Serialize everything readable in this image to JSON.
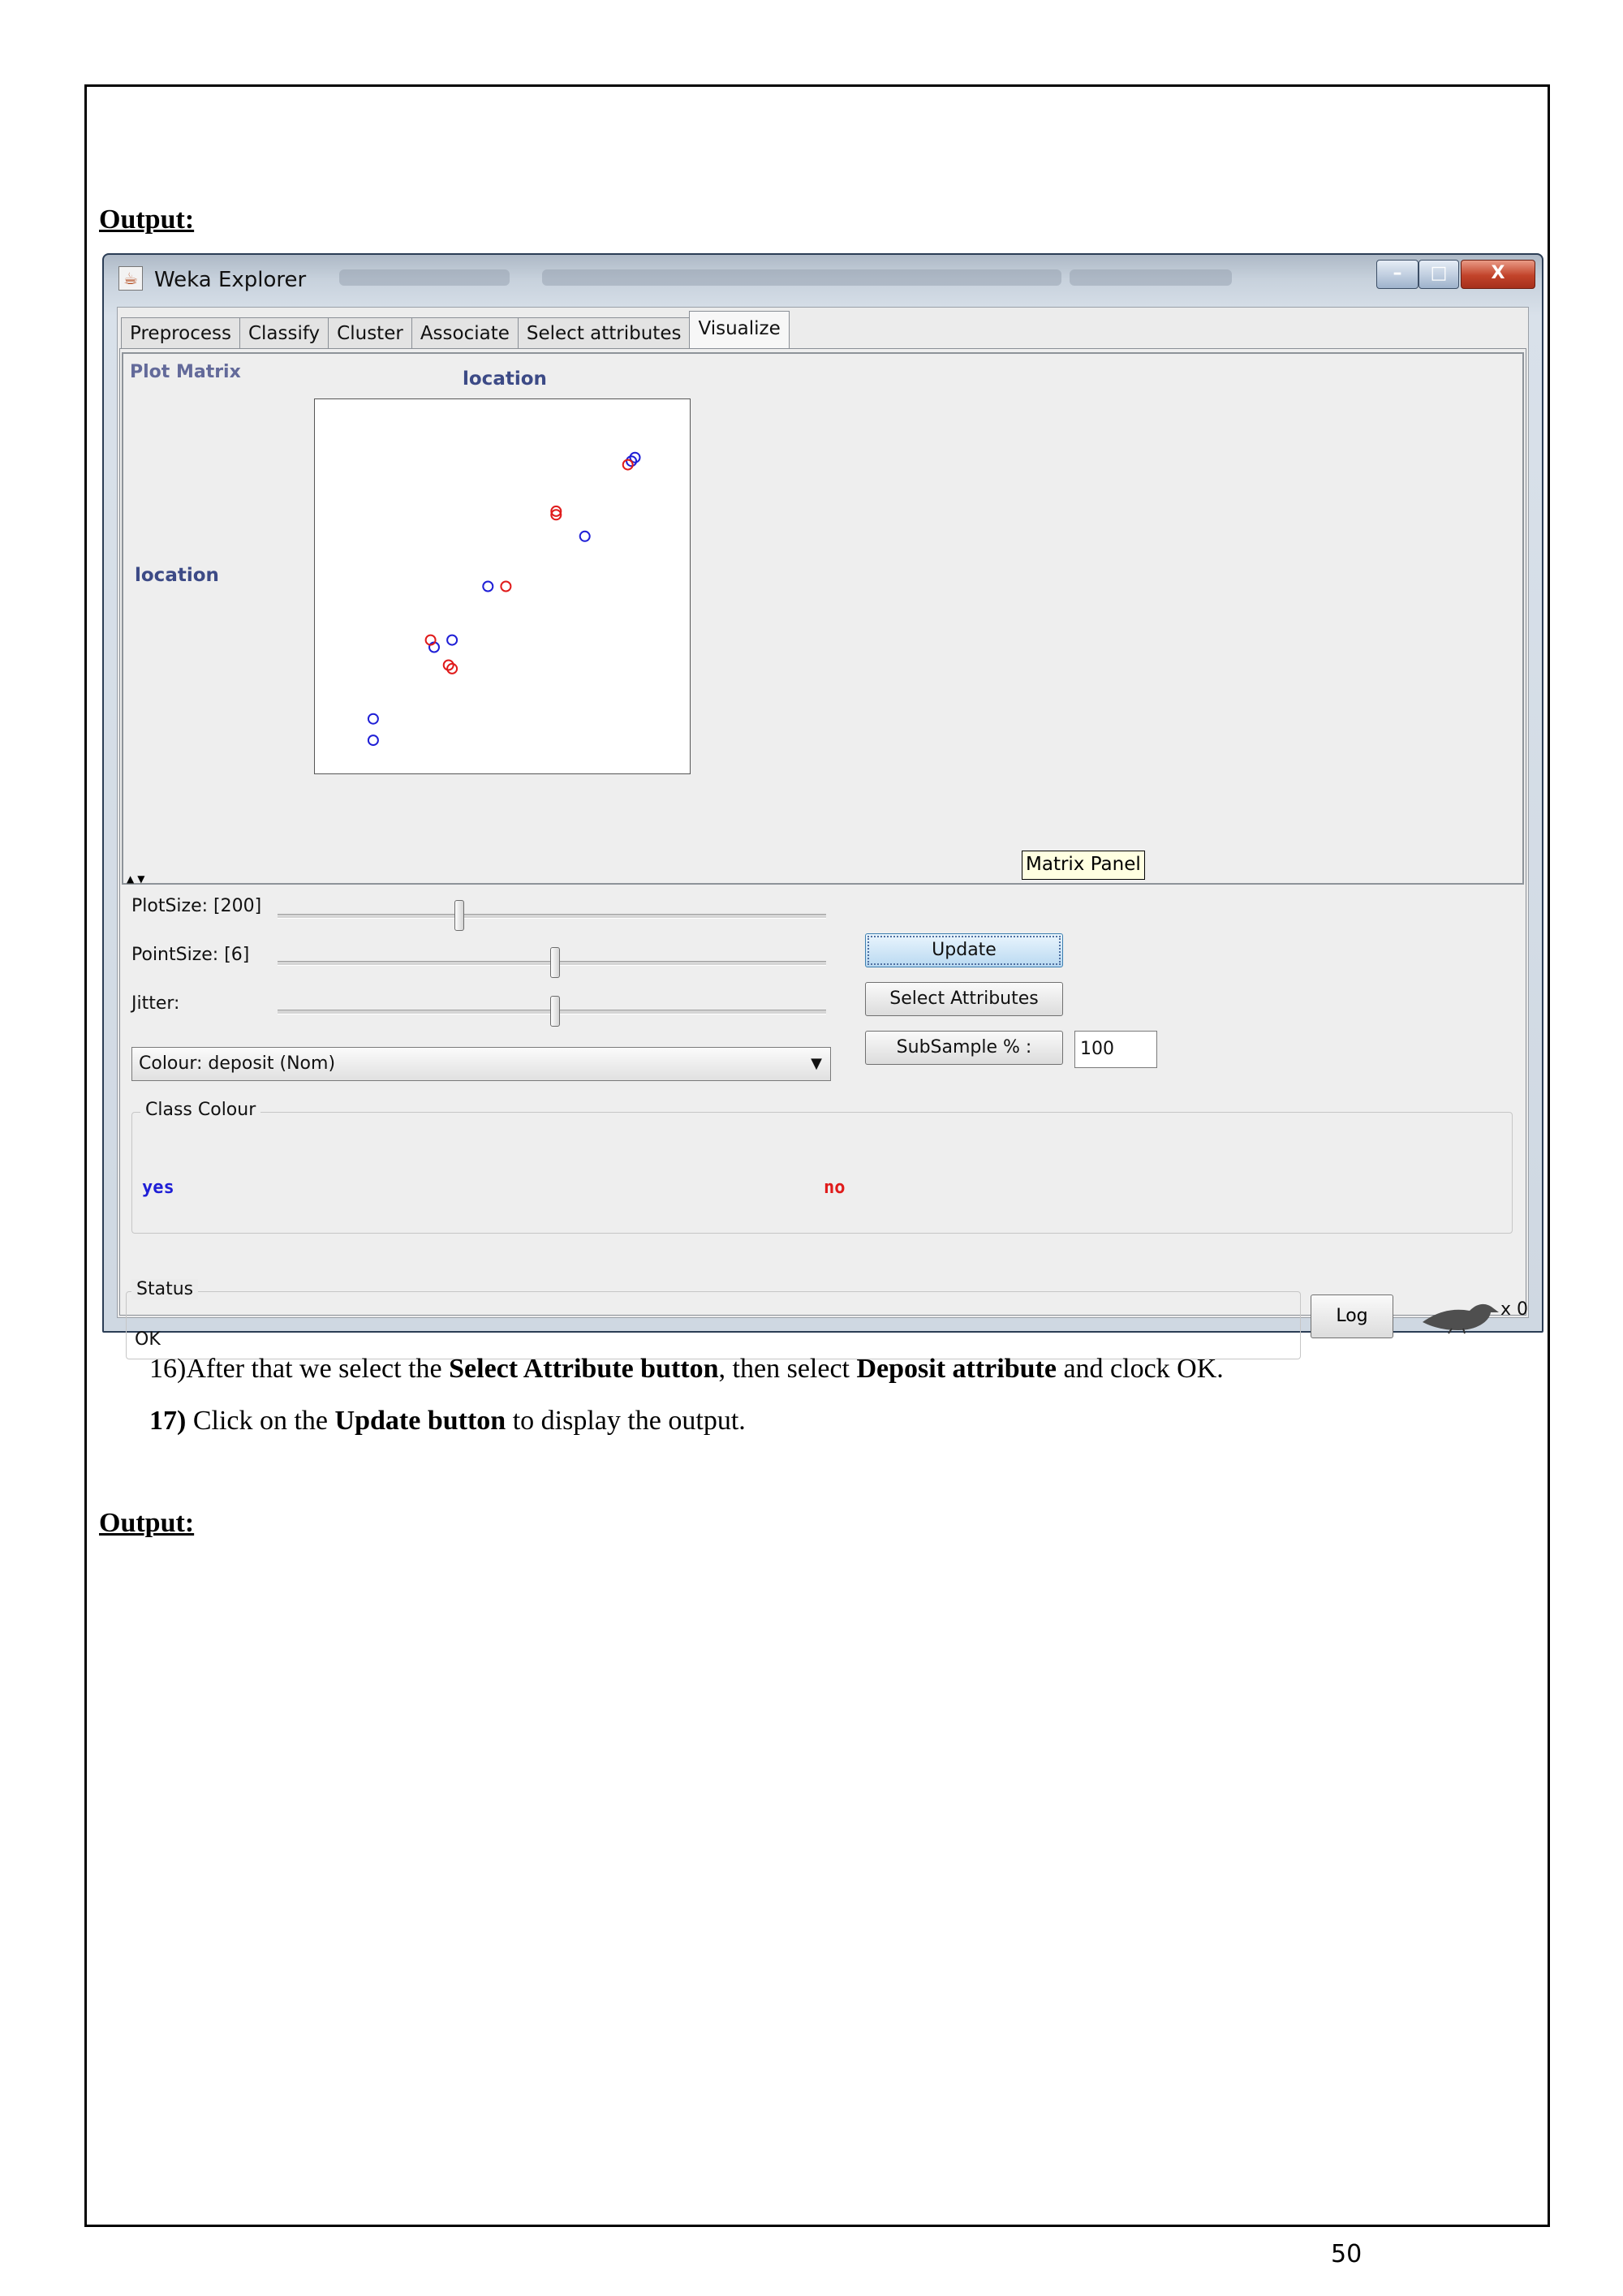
{
  "document": {
    "heading_top": "Output:",
    "heading_bottom": "Output:",
    "step16": {
      "prefix": "16)After that we select the ",
      "bold1": "Select Attribute button",
      "mid": ", then select ",
      "bold2": "Deposit attribute",
      "suffix": " and clock OK."
    },
    "step17": {
      "prefix": "17)",
      "text1": " Click on the ",
      "bold": "Update button",
      "suffix": " to display the output."
    },
    "page_number": "50"
  },
  "window": {
    "title": "Weka Explorer",
    "title_icon": "weka-java-icon",
    "controls": [
      "minimize-icon",
      "maximize-icon",
      "close-icon"
    ],
    "tabs": [
      {
        "label": "Preprocess"
      },
      {
        "label": "Classify"
      },
      {
        "label": "Cluster"
      },
      {
        "label": "Associate"
      },
      {
        "label": "Select attributes"
      },
      {
        "label": "Visualize",
        "active": true
      }
    ],
    "matrix": {
      "title": "Plot Matrix",
      "column_attribute": "location",
      "row_attribute": "location",
      "tooltip": "Matrix Panel"
    },
    "controls_panel": {
      "plot_size_label": "PlotSize: [200]",
      "plot_size_value": 200,
      "point_size_label": "PointSize: [6]",
      "point_size_value": 6,
      "jitter_label": "Jitter:",
      "colour_select": "Colour: deposit  (Nom)",
      "update_button": "Update",
      "select_attributes_button": "Select Attributes",
      "subsample_button": "SubSample % :",
      "subsample_value": "100"
    },
    "class_colour": {
      "legend": "Class Colour",
      "classes": [
        {
          "label": "yes",
          "color": "#1f1fd6"
        },
        {
          "label": "no",
          "color": "#e01b1b"
        }
      ]
    },
    "status": {
      "legend": "Status",
      "text": "OK",
      "log_button": "Log",
      "task_icon": "weka-bird-icon",
      "task_count": "x 0"
    }
  },
  "chart_data": {
    "type": "scatter",
    "title": "",
    "xlabel": "location",
    "ylabel": "location",
    "xlim": [
      0,
      1
    ],
    "ylim": [
      0,
      1
    ],
    "series": [
      {
        "name": "yes",
        "color": "#1f1fd6",
        "points": [
          [
            0.87,
            0.86
          ],
          [
            0.86,
            0.85
          ],
          [
            0.73,
            0.64
          ],
          [
            0.46,
            0.5
          ],
          [
            0.36,
            0.35
          ],
          [
            0.31,
            0.33
          ],
          [
            0.14,
            0.13
          ],
          [
            0.14,
            0.07
          ]
        ]
      },
      {
        "name": "no",
        "color": "#e01b1b",
        "points": [
          [
            0.85,
            0.84
          ],
          [
            0.65,
            0.71
          ],
          [
            0.65,
            0.7
          ],
          [
            0.51,
            0.5
          ],
          [
            0.3,
            0.35
          ],
          [
            0.35,
            0.28
          ],
          [
            0.36,
            0.27
          ]
        ]
      }
    ]
  }
}
